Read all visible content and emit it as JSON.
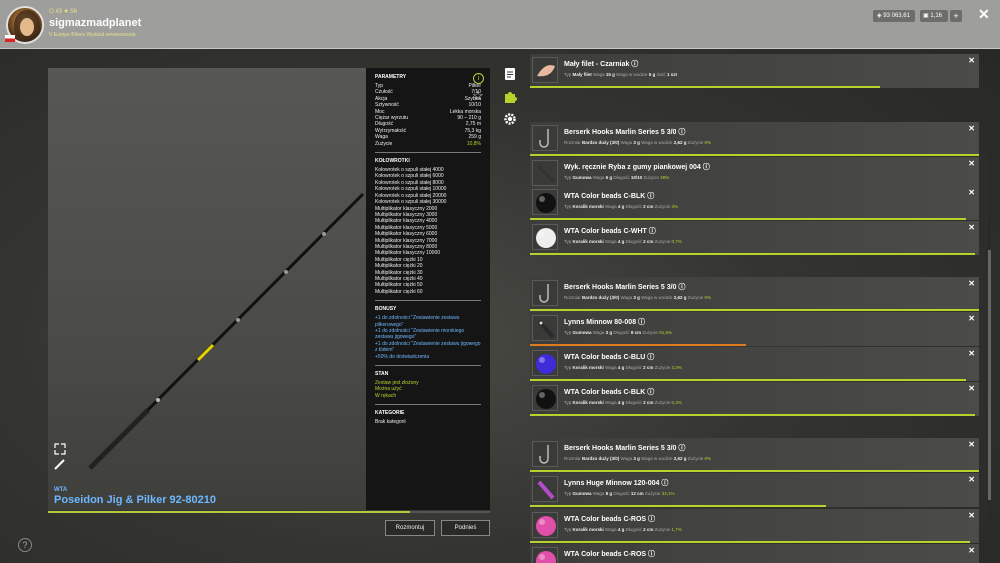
{
  "user": {
    "stats_text": "⭘ 43 ★ 56",
    "name": "sigmazmadplanet",
    "subline": "V Europe Bikers Wydział serwisowania"
  },
  "currency": {
    "money": "93 063,61",
    "gold": "1,16",
    "plus_label": "+"
  },
  "close_label": "✕",
  "rod": {
    "brand": "WTA",
    "name": "Poseidon Jig & Pilker 92-80210",
    "condition_fraction": 0.82
  },
  "params": {
    "header": "PARAMETRY",
    "rows": [
      {
        "k": "Typ",
        "v": "Pilker"
      },
      {
        "k": "Czułość",
        "v": "7/10"
      },
      {
        "k": "Akcja",
        "v": "Szybka"
      },
      {
        "k": "Sztywność",
        "v": "10/10"
      },
      {
        "k": "Moc",
        "v": "Lekka morska"
      },
      {
        "k": "Ciężar wyrzutu",
        "v": "90 – 210 g"
      },
      {
        "k": "Długość",
        "v": "2,75 m"
      },
      {
        "k": "Wytrzymałość",
        "v": "75,3 kg"
      },
      {
        "k": "Waga",
        "v": "259 g"
      },
      {
        "k": "Zużycie",
        "v": "10,8%"
      }
    ]
  },
  "reels": {
    "header": "KOŁOWROTKI",
    "rows": [
      "Kołowrotek o szpuli stałej 4000",
      "Kołowrotek o szpuli stałej 6000",
      "Kołowrotek o szpuli stałej 8000",
      "Kołowrotek o szpuli stałej 10000",
      "Kołowrotek o szpuli stałej 20000",
      "Kołowrotek o szpuli stałej 30000",
      "Multiplikator klasyczny 2000",
      "Multiplikator klasyczny 3000",
      "Multiplikator klasyczny 4000",
      "Multiplikator klasyczny 5000",
      "Multiplikator klasyczny 6000",
      "Multiplikator klasyczny 7000",
      "Multiplikator klasyczny 8000",
      "Multiplikator klasyczny 10000",
      "Multiplikator ciężki 10",
      "Multiplikator ciężki 20",
      "Multiplikator ciężki 30",
      "Multiplikator ciężki 40",
      "Multiplikator ciężki 50",
      "Multiplikator ciężki 60"
    ]
  },
  "bonus": {
    "header": "BONUSY",
    "rows": [
      "+1 do zdolności \"Zestawienie zestawu pilkerowego\"",
      "+1 do zdolności \"Zestawienie morskiego zestawu jigowego\"",
      "+1 do zdolności \"Zestawienie zestawu jigowego z łódem\"",
      "+50% do doświadczenia"
    ]
  },
  "state": {
    "header": "STAN",
    "rows": [
      "Zestaw jest złożony",
      "Można użyć",
      "W rękach"
    ]
  },
  "category": {
    "header": "KATEGORIE",
    "value": "Brak kategorii"
  },
  "buttons": {
    "dismantle": "Rozmontuj",
    "pickup": "Podnieś"
  },
  "help_label": "?",
  "items": [
    {
      "name": "Mały filet - Czarniak",
      "thumb": "fillet",
      "details": [
        [
          "Typ",
          "Mały filet"
        ],
        [
          "Waga",
          "15 g"
        ],
        [
          "Waga w wodzie",
          "5 g"
        ],
        [
          "Ilość",
          "1 szt"
        ]
      ],
      "wear": "",
      "bar": 0.78,
      "barColor": "#b8d22c"
    },
    {
      "name": "Berserk Hooks Marlin Series 5 3/0",
      "thumb": "hook",
      "details": [
        [
          "Rozmiar",
          "Bardzo duży (3/0)"
        ],
        [
          "Waga",
          "3 g"
        ],
        [
          "Waga w wodzie",
          "2,62 g"
        ]
      ],
      "wear": "0%",
      "bar": 1,
      "barColor": "#b8d22c"
    },
    {
      "name": "Wyk. ręcznie Ryba z gumy piankowej 004",
      "thumb": "lure",
      "details": [
        [
          "Typ",
          "Gumowa"
        ],
        [
          "Waga",
          "6 g"
        ],
        [
          "Długość",
          "10/10"
        ]
      ],
      "wear": "28%",
      "bar": 0.72,
      "barColor": "#b8d22c"
    },
    {
      "name": "WTA Color beads C-BLK",
      "thumb": "bead-black",
      "details": [
        [
          "Typ",
          "Koralik morski"
        ],
        [
          "Waga",
          "4 g"
        ],
        [
          "Długość",
          "2 cm"
        ]
      ],
      "wear": "3%",
      "bar": 0.97,
      "barColor": "#b8d22c"
    },
    {
      "name": "WTA Color beads C-WHT",
      "thumb": "bead-white",
      "details": [
        [
          "Typ",
          "Koralik morski"
        ],
        [
          "Waga",
          "4 g"
        ],
        [
          "Długość",
          "2 cm"
        ]
      ],
      "wear": "0,7%",
      "bar": 0.99,
      "barColor": "#b8d22c"
    },
    {
      "name": "Berserk Hooks Marlin Series 5 3/0",
      "thumb": "hook",
      "details": [
        [
          "Rozmiar",
          "Bardzo duży (3/0)"
        ],
        [
          "Waga",
          "3 g"
        ],
        [
          "Waga w wodzie",
          "2,62 g"
        ]
      ],
      "wear": "0%",
      "bar": 1,
      "barColor": "#b8d22c"
    },
    {
      "name": "Lynns Minnow 80-008",
      "thumb": "minnow",
      "details": [
        [
          "Typ",
          "Gumowa"
        ],
        [
          "Waga",
          "3 g"
        ],
        [
          "Długość",
          "8 cm"
        ]
      ],
      "wear": "51,6%",
      "bar": 0.48,
      "barColor": "#e07a1e"
    },
    {
      "name": "WTA Color beads C-BLU",
      "thumb": "bead-blue",
      "details": [
        [
          "Typ",
          "Koralik morski"
        ],
        [
          "Waga",
          "4 g"
        ],
        [
          "Długość",
          "2 cm"
        ]
      ],
      "wear": "3,3%",
      "bar": 0.97,
      "barColor": "#b8d22c"
    },
    {
      "name": "WTA Color beads C-BLK",
      "thumb": "bead-black",
      "details": [
        [
          "Typ",
          "Koralik morski"
        ],
        [
          "Waga",
          "4 g"
        ],
        [
          "Długość",
          "2 cm"
        ]
      ],
      "wear": "0,4%",
      "bar": 0.99,
      "barColor": "#b8d22c"
    },
    {
      "name": "Berserk Hooks Marlin Series 5 3/0",
      "thumb": "hook",
      "details": [
        [
          "Rozmiar",
          "Bardzo duży (3/0)"
        ],
        [
          "Waga",
          "3 g"
        ],
        [
          "Waga w wodzie",
          "2,62 g"
        ]
      ],
      "wear": "0%",
      "bar": 1,
      "barColor": "#b8d22c"
    },
    {
      "name": "Lynns Huge Minnow 120-004",
      "thumb": "minnow-purple",
      "details": [
        [
          "Typ",
          "Gumowa"
        ],
        [
          "Waga",
          "8 g"
        ],
        [
          "Długość",
          "12 cm"
        ]
      ],
      "wear": "34,1%",
      "bar": 0.66,
      "barColor": "#b8d22c"
    },
    {
      "name": "WTA Color beads C-ROS",
      "thumb": "bead-pink",
      "details": [
        [
          "Typ",
          "Koralik morski"
        ],
        [
          "Waga",
          "4 g"
        ],
        [
          "Długość",
          "2 cm"
        ]
      ],
      "wear": "1,7%",
      "bar": 0.98,
      "barColor": "#b8d22c"
    },
    {
      "name": "WTA Color beads C-ROS",
      "thumb": "bead-pink",
      "details": [],
      "wear": "",
      "bar": 0,
      "barColor": "#b8d22c"
    }
  ],
  "wear_label": "Zużycie"
}
